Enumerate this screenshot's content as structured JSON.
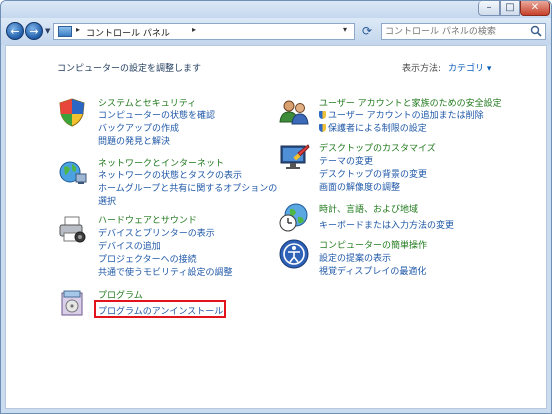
{
  "address": {
    "crumb": "コントロール パネル"
  },
  "search": {
    "placeholder": "コントロール パネルの検索"
  },
  "window_controls": {
    "minimize": "–",
    "maximize": "□",
    "close": "✕"
  },
  "content": {
    "heading": "コンピューターの設定を調整します",
    "view_by_label": "表示方法:",
    "view_by_value": "カテゴリ ▾"
  },
  "categories": {
    "system": {
      "title": "システムとセキュリティ",
      "links": [
        "コンピューターの状態を確認",
        "バックアップの作成",
        "問題の発見と解決"
      ]
    },
    "network": {
      "title": "ネットワークとインターネット",
      "links": [
        "ネットワークの状態とタスクの表示",
        "ホームグループと共有に関するオプションの",
        "選択"
      ]
    },
    "hardware": {
      "title": "ハードウェアとサウンド",
      "links": [
        "デバイスとプリンターの表示",
        "デバイスの追加",
        "プロジェクターへの接続",
        "共通で使うモビリティ設定の調整"
      ]
    },
    "programs": {
      "title": "プログラム",
      "links": [
        "プログラムのアンインストール"
      ]
    },
    "users": {
      "title": "ユーザー アカウントと家族のための安全設定",
      "links": [
        "ユーザー アカウントの追加または削除",
        "保護者による制限の設定"
      ]
    },
    "appearance": {
      "title": "デスクトップのカスタマイズ",
      "links": [
        "テーマの変更",
        "デスクトップの背景の変更",
        "画面の解像度の調整"
      ]
    },
    "clock": {
      "title": "時計、言語、および地域",
      "links": [
        "キーボードまたは入力方法の変更"
      ]
    },
    "ease": {
      "title": "コンピューターの簡単操作",
      "links": [
        "設定の提案の表示",
        "視覚ディスプレイの最適化"
      ]
    }
  },
  "colors": {
    "highlight": "#e0141a",
    "title_green": "#207a1c",
    "link_blue": "#1f58a8"
  }
}
